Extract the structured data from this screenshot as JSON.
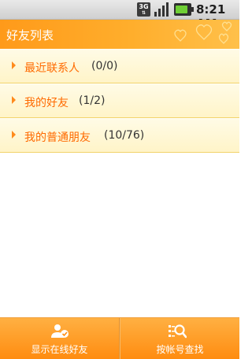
{
  "status_bar": {
    "network": "3G",
    "time": "8:21 AM"
  },
  "header": {
    "title": "好友列表"
  },
  "groups": [
    {
      "label": "最近联系人",
      "count": "(0/0)"
    },
    {
      "label": "我的好友",
      "count": "(1/2)"
    },
    {
      "label": "我的普通朋友",
      "count": "(10/76)"
    }
  ],
  "bottom_bar": {
    "show_online": {
      "label": "显示在线好友",
      "icon": "online-friends-icon"
    },
    "search_account": {
      "label": "按帐号查找",
      "icon": "search-account-icon"
    }
  },
  "colors": {
    "accent": "#ff9a1a",
    "group_label": "#ff6a00",
    "list_background": "#fff6d6"
  }
}
